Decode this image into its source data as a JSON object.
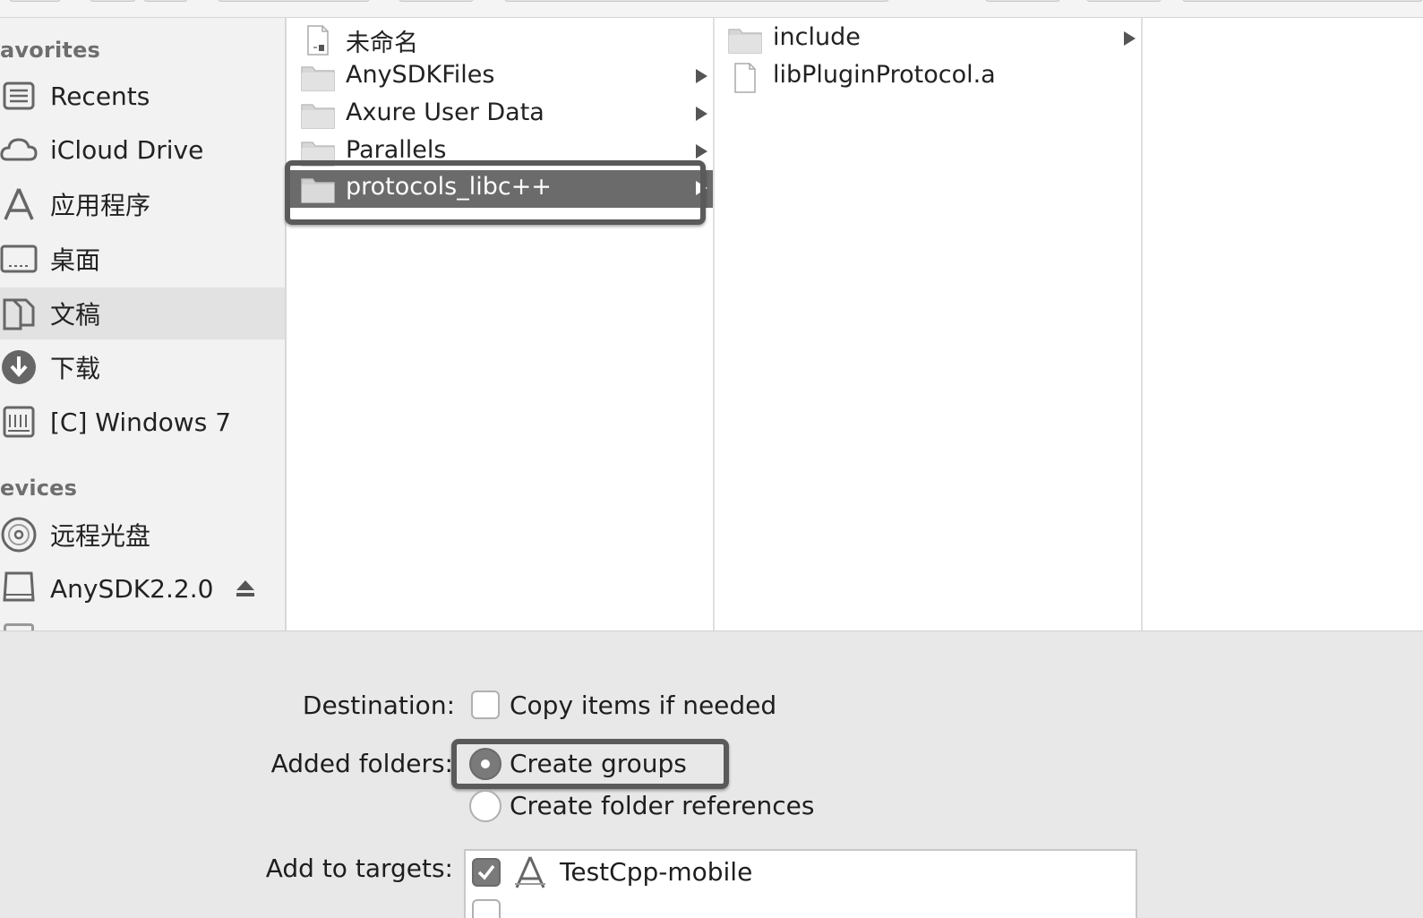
{
  "sidebar": {
    "sections": [
      {
        "label": "avorites"
      },
      {
        "label": "evices"
      }
    ],
    "favorites": [
      {
        "label": "Recents",
        "icon": "recents-icon"
      },
      {
        "label": "iCloud Drive",
        "icon": "cloud-icon"
      },
      {
        "label": "应用程序",
        "icon": "applications-icon"
      },
      {
        "label": "桌面",
        "icon": "desktop-icon"
      },
      {
        "label": "文稿",
        "icon": "documents-icon",
        "selected": true
      },
      {
        "label": "下载",
        "icon": "downloads-icon"
      },
      {
        "label": "[C] Windows 7",
        "icon": "network-drive-icon"
      }
    ],
    "devices": [
      {
        "label": "远程光盘",
        "icon": "optical-disc-icon"
      },
      {
        "label": "AnySDK2.2.0",
        "icon": "disk-icon",
        "eject": true
      }
    ]
  },
  "columns": {
    "col1": [
      {
        "label": "未命名",
        "icon": "document-file-icon",
        "has_children": false
      },
      {
        "label": "AnySDKFiles",
        "icon": "folder-icon",
        "has_children": true
      },
      {
        "label": "Axure User Data",
        "icon": "folder-icon",
        "has_children": true
      },
      {
        "label": "Parallels",
        "icon": "folder-icon",
        "has_children": true
      },
      {
        "label": "protocols_libc++",
        "icon": "folder-icon",
        "has_children": true,
        "selected": true
      }
    ],
    "col2": [
      {
        "label": "include",
        "icon": "folder-icon",
        "has_children": true
      },
      {
        "label": "libPluginProtocol.a",
        "icon": "blank-file-icon",
        "has_children": false
      }
    ]
  },
  "options": {
    "destination_label": "Destination:",
    "copy_items_label": "Copy items if needed",
    "copy_items_checked": false,
    "added_folders_label": "Added folders:",
    "create_groups_label": "Create groups",
    "create_groups_selected": true,
    "create_folder_refs_label": "Create folder references",
    "create_folder_refs_selected": false,
    "add_to_targets_label": "Add to targets:",
    "targets": [
      {
        "label": "TestCpp-mobile",
        "checked": true
      }
    ]
  },
  "colors": {
    "selection": "#6b6b6b",
    "highlight_border": "#5a5a5a",
    "sidebar_bg": "#f2f2f2",
    "panel_bg": "#e8e8e8"
  }
}
